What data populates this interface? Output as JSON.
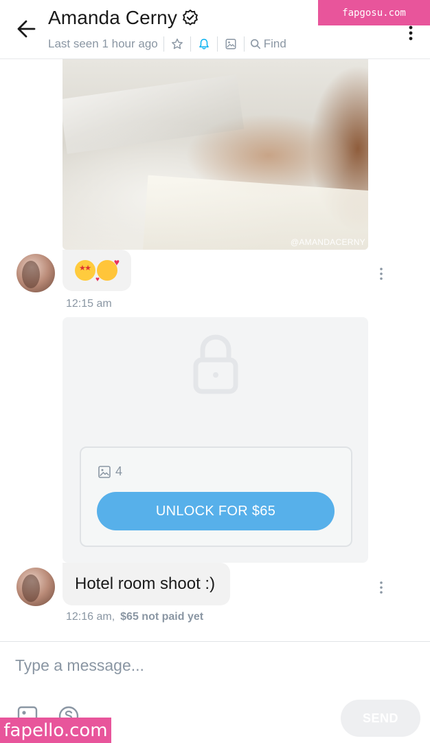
{
  "watermarks": {
    "top": "fapgosu.com",
    "bottom": "fapello.com"
  },
  "header": {
    "back_icon": "arrow-left-icon",
    "title": "Amanda Cerny",
    "verified_icon": "verified-badge-icon",
    "last_seen": "Last seen 1 hour ago",
    "icons": [
      "star-icon",
      "bell-icon",
      "image-icon",
      "search-icon"
    ],
    "find_label": "Find",
    "menu_icon": "kebab-menu-icon",
    "accent_color": "#00aff0"
  },
  "messages": [
    {
      "type": "photo",
      "credit": "@AMANDACERNY"
    },
    {
      "type": "emoji",
      "emojis": [
        "star-struck-emoji",
        "smiling-face-with-hearts-emoji"
      ],
      "time": "12:15 am"
    },
    {
      "type": "locked",
      "media_icon": "image-icon",
      "media_count": "4",
      "unlock_label": "UNLOCK FOR $65",
      "button_color": "#57b0ea"
    },
    {
      "type": "text",
      "text": "Hotel room shoot :)",
      "time": "12:16 am,",
      "payment_status": "$65 not paid yet"
    }
  ],
  "composer": {
    "placeholder": "Type a message...",
    "tools": [
      "image-icon",
      "dollar-icon"
    ],
    "send_label": "SEND"
  }
}
